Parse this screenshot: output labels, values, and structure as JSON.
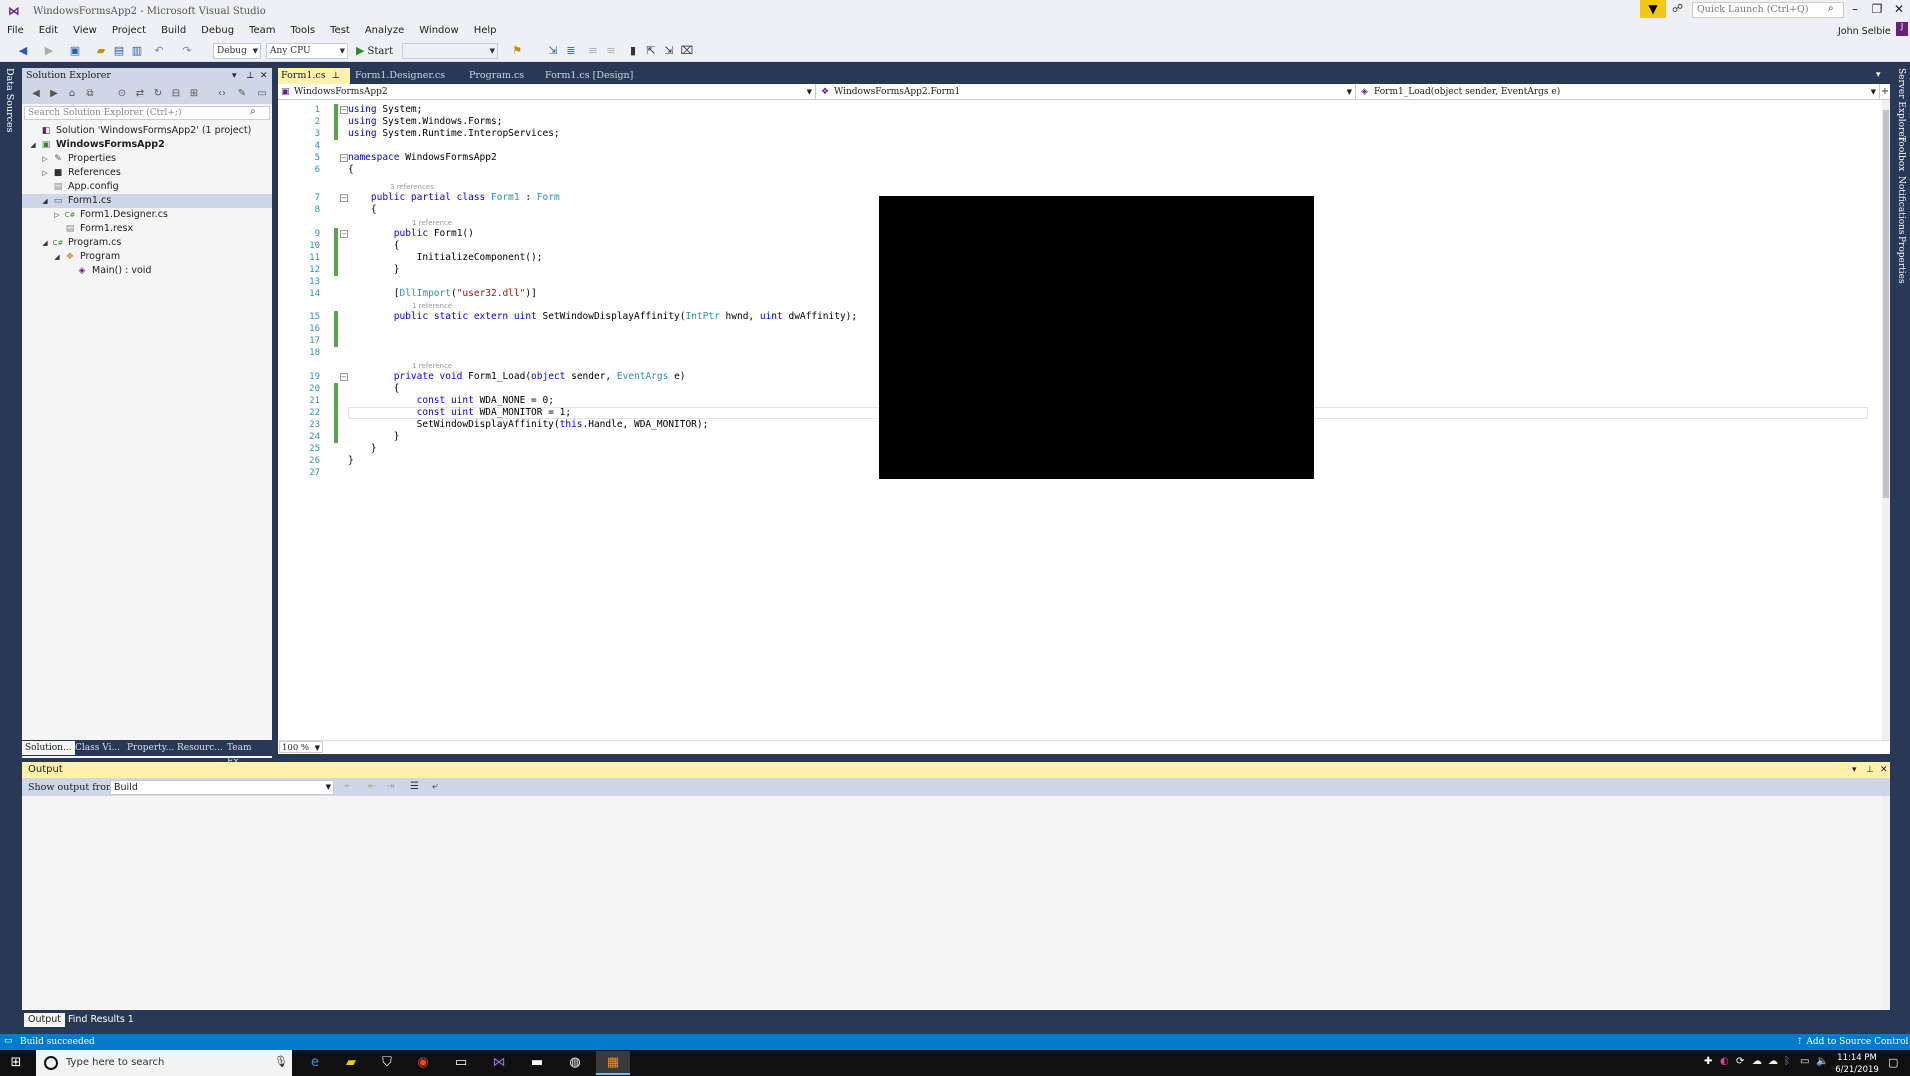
{
  "window": {
    "title": "WindowsFormsApp2 - Microsoft Visual Studio",
    "quick_launch_placeholder": "Quick Launch (Ctrl+Q)",
    "user_name": "John Selbie",
    "user_initial": "J"
  },
  "menu": [
    "File",
    "Edit",
    "View",
    "Project",
    "Build",
    "Debug",
    "Team",
    "Tools",
    "Test",
    "Analyze",
    "Window",
    "Help"
  ],
  "toolbar": {
    "config": "Debug",
    "platform": "Any CPU",
    "start_label": "Start"
  },
  "left_vtab": "Data Sources",
  "solution_explorer": {
    "title": "Solution Explorer",
    "search_placeholder": "Search Solution Explorer (Ctrl+;)",
    "tree": [
      {
        "label": "Solution 'WindowsFormsApp2' (1 project)",
        "depth": 0,
        "bold": false,
        "twisty": "",
        "icon": "solution-icon"
      },
      {
        "label": "WindowsFormsApp2",
        "depth": 0,
        "bold": true,
        "twisty": "◢",
        "icon": "csharp-project-icon"
      },
      {
        "label": "Properties",
        "depth": 1,
        "bold": false,
        "twisty": "▷",
        "icon": "wrench-icon"
      },
      {
        "label": "References",
        "depth": 1,
        "bold": false,
        "twisty": "▷",
        "icon": "references-icon"
      },
      {
        "label": "App.config",
        "depth": 1,
        "bold": false,
        "twisty": "",
        "icon": "config-file-icon"
      },
      {
        "label": "Form1.cs",
        "depth": 1,
        "bold": false,
        "twisty": "◢",
        "icon": "form-icon",
        "selected": true
      },
      {
        "label": "Form1.Designer.cs",
        "depth": 2,
        "bold": false,
        "twisty": "▷",
        "icon": "csharp-file-icon"
      },
      {
        "label": "Form1.resx",
        "depth": 2,
        "bold": false,
        "twisty": "",
        "icon": "resx-file-icon"
      },
      {
        "label": "Program.cs",
        "depth": 1,
        "bold": false,
        "twisty": "◢",
        "icon": "csharp-file-icon"
      },
      {
        "label": "Program",
        "depth": 2,
        "bold": false,
        "twisty": "◢",
        "icon": "class-icon"
      },
      {
        "label": "Main() : void",
        "depth": 3,
        "bold": false,
        "twisty": "",
        "icon": "method-icon"
      }
    ],
    "bottom_tabs": [
      "Solution...",
      "Class Vi...",
      "Property...",
      "Resourc...",
      "Team Ex..."
    ]
  },
  "editor": {
    "tabs": [
      {
        "label": "Form1.cs",
        "active": true
      },
      {
        "label": "Form1.Designer.cs",
        "active": false
      },
      {
        "label": "Program.cs",
        "active": false
      },
      {
        "label": "Form1.cs [Design]",
        "active": false
      }
    ],
    "nav": {
      "project": "WindowsFormsApp2",
      "type": "WindowsFormsApp2.Form1",
      "member": "Form1_Load(object sender, EventArgs e)"
    },
    "zoom": "100 %",
    "codelens": {
      "l7": "3 references",
      "l9": "1 reference",
      "l15": "1 reference",
      "l19": "1 reference"
    },
    "lines": [
      {
        "n": "1",
        "html": "<span class=\"kw\">using</span> System;"
      },
      {
        "n": "2",
        "html": "<span class=\"kw\">using</span> System.Windows.Forms;"
      },
      {
        "n": "3",
        "html": "<span class=\"kw\">using</span> System.Runtime.InteropServices;"
      },
      {
        "n": "4",
        "html": ""
      },
      {
        "n": "5",
        "html": "<span class=\"kw\">namespace</span> WindowsFormsApp2"
      },
      {
        "n": "6",
        "html": "{"
      },
      {
        "n": "7",
        "html": "    <span class=\"kw\">public partial class</span> <span class=\"ty\">Form1</span> : <span class=\"ty\">Form</span>"
      },
      {
        "n": "8",
        "html": "    {"
      },
      {
        "n": "9",
        "html": "        <span class=\"kw\">public</span> Form1()"
      },
      {
        "n": "10",
        "html": "        {"
      },
      {
        "n": "11",
        "html": "            InitializeComponent();"
      },
      {
        "n": "12",
        "html": "        }"
      },
      {
        "n": "13",
        "html": ""
      },
      {
        "n": "14",
        "html": "        [<span class=\"ty\">DllImport</span>(<span class=\"str\">\"user32.dll\"</span>)]"
      },
      {
        "n": "15",
        "html": "        <span class=\"kw\">public static extern uint</span> SetWindowDisplayAffinity(<span class=\"ty\">IntPtr</span> hwnd, <span class=\"kw\">uint</span> dwAffinity);"
      },
      {
        "n": "16",
        "html": ""
      },
      {
        "n": "17",
        "html": ""
      },
      {
        "n": "18",
        "html": ""
      },
      {
        "n": "19",
        "html": "        <span class=\"kw\">private void</span> Form1_Load(<span class=\"kw\">object</span> sender, <span class=\"ty\">EventArgs</span> e)"
      },
      {
        "n": "20",
        "html": "        {"
      },
      {
        "n": "21",
        "html": "            <span class=\"kw\">const uint</span> WDA_NONE = 0;"
      },
      {
        "n": "22",
        "html": "            <span class=\"kw\">const uint</span> WDA_MONITOR = 1;"
      },
      {
        "n": "23",
        "html": "            SetWindowDisplayAffinity(<span class=\"kw\">this</span>.Handle, WDA_MONITOR);"
      },
      {
        "n": "24",
        "html": "        }"
      },
      {
        "n": "25",
        "html": "    }"
      },
      {
        "n": "26",
        "html": "}"
      },
      {
        "n": "27",
        "html": ""
      }
    ]
  },
  "right_vtabs": [
    "Server Explorer",
    "Toolbox",
    "Notifications",
    "Properties"
  ],
  "output": {
    "title": "Output",
    "show_from_label": "Show output from:",
    "show_from_value": "Build",
    "bottom_tabs": [
      "Output",
      "Find Results 1"
    ]
  },
  "status": {
    "text": "Build succeeded",
    "source_control": "Add to Source Control"
  },
  "taskbar": {
    "search_placeholder": "Type here to search",
    "time": "11:14 PM",
    "date": "6/21/2019"
  }
}
